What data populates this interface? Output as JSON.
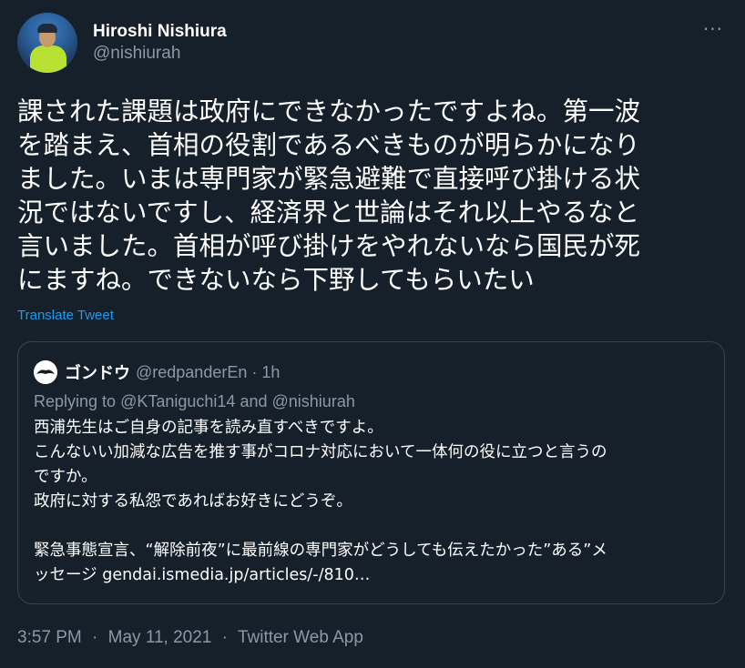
{
  "author": {
    "display_name": "Hiroshi Nishiura",
    "handle": "@nishiurah"
  },
  "more_icon": "···",
  "tweet_text": "課された課題は政府にできなかったですよね。第一波\nを踏まえ、首相の役割であるべきものが明らかになり\nました。いまは専門家が緊急避難で直接呼び掛ける状\n況ではないですし、経済界と世論はそれ以上やるなと\n言いました。首相が呼び掛けをやれないなら国民が死\nにますね。できないなら下野してもらいたい",
  "translate_label": "Translate Tweet",
  "quoted": {
    "display_name": "ゴンドウ",
    "handle": "@redpanderEn",
    "dot": "·",
    "time": "1h",
    "reply_prefix": "Replying to",
    "reply_mention_1": "@KTaniguchi14",
    "reply_and": "and",
    "reply_mention_2": "@nishiurah",
    "text": "西浦先生はご自身の記事を読み直すべきですよ。\nこんないい加減な広告を推す事がコロナ対応において一体何の役に立つと言うの\nですか。\n政府に対する私怨であればお好きにどうぞ。\n\n緊急事態宣言、“解除前夜”に最前線の専門家がどうしても伝えたかった”ある”メ\nッセージ gendai.ismedia.jp/articles/-/810…"
  },
  "meta": {
    "time": "3:57 PM",
    "sep1": "·",
    "date": "May 11, 2021",
    "sep2": "·",
    "source": "Twitter Web App"
  },
  "colors": {
    "background": "#15202b",
    "text": "#ffffff",
    "secondary": "#8b98a5",
    "link": "#1d9bf0",
    "border": "#38444d"
  }
}
